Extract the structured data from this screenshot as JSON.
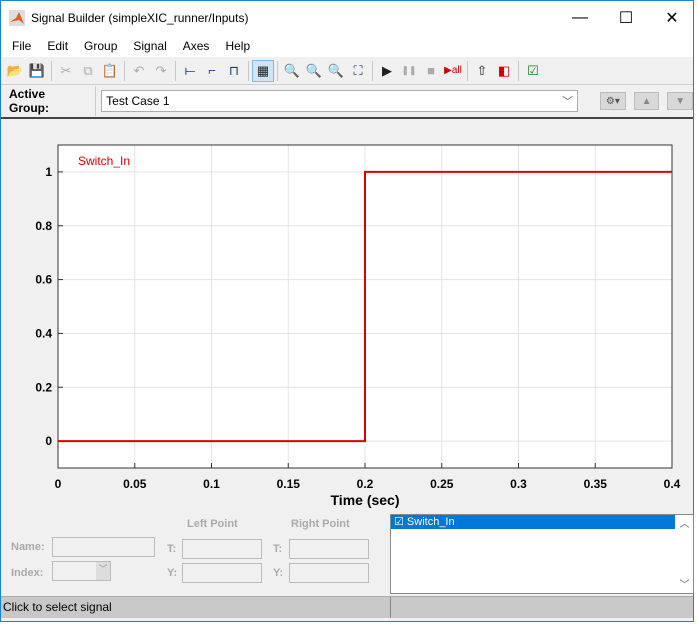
{
  "window": {
    "title": "Signal Builder (simpleXIC_runner/Inputs)",
    "minimize": "—",
    "maximize": "☐",
    "close": "✕"
  },
  "menu": [
    "File",
    "Edit",
    "Group",
    "Signal",
    "Axes",
    "Help"
  ],
  "toolbar": {
    "play": "▶",
    "pause": "❚❚",
    "stop": "■",
    "play_all": "▶all"
  },
  "group": {
    "label": "Active Group:",
    "value": "Test Case 1"
  },
  "chart_data": {
    "type": "line",
    "xlabel": "Time (sec)",
    "ylabel": "",
    "xlim": [
      0,
      0.4
    ],
    "ylim": [
      -0.1,
      1.1
    ],
    "xticks": [
      "0",
      "0.05",
      "0.1",
      "0.15",
      "0.2",
      "0.25",
      "0.3",
      "0.35",
      "0.4"
    ],
    "yticks": [
      "0",
      "0.2",
      "0.4",
      "0.6",
      "0.8",
      "1"
    ],
    "grid": true,
    "series": [
      {
        "name": "Switch_In",
        "color": "#e00000",
        "x": [
          0,
          0.2,
          0.2,
          0.4
        ],
        "y": [
          0,
          0,
          1,
          1
        ]
      }
    ]
  },
  "editor": {
    "left_point": "Left Point",
    "right_point": "Right Point",
    "name": "Name:",
    "index": "Index:",
    "t": "T:",
    "y": "Y:"
  },
  "signals": [
    {
      "label": "☑ Switch_In"
    }
  ],
  "status": "Click to select signal"
}
